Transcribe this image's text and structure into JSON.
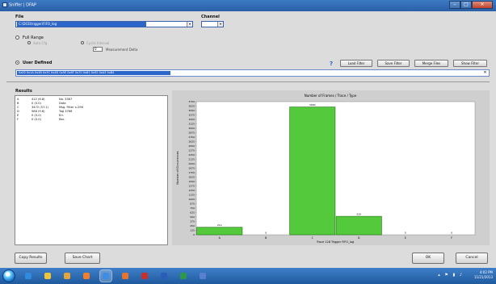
{
  "window": {
    "title": "Sniffer | DFAP",
    "controls": [
      "–",
      "□",
      "✕"
    ]
  },
  "file": {
    "label": "File",
    "value": "C:\\DCE\\trigger\\FIFO_log"
  },
  "channel": {
    "label": "Channel",
    "value": "1"
  },
  "options": {
    "full_range_label": "Full Range",
    "auto_label": "Auto Cfg",
    "opt2_label": "Cyclic Interval",
    "tiny_value": "0",
    "measurement_label": "Measurement Delta",
    "user_defined_label": "User Defined"
  },
  "toolbar": {
    "help_label": "?",
    "buttons": [
      "Load Filter",
      "Save Filter",
      "Merge Files",
      "Show Filter"
    ]
  },
  "user_input": {
    "value": "0x00 0x1A 0x2B 0x3C 0x4D 0x5E 0x6F 0x70 0x81 0x92 0xA3 0xB4"
  },
  "results": {
    "label": "Results",
    "rows": [
      {
        "key": "A",
        "col2": "412 (6.8)",
        "col3": "No. 3387"
      },
      {
        "key": "B",
        "col2": "0 (0.0)",
        "col3": "Data"
      },
      {
        "key": "C",
        "col2": "3472 (57.1)",
        "col3": "Msg. Filter x-296"
      },
      {
        "key": "D",
        "col2": "586 (9.6)",
        "col3": "Tag 3766"
      },
      {
        "key": "E",
        "col2": "0 (0.0)",
        "col3": "Err."
      },
      {
        "key": "F",
        "col2": "0 (0.0)",
        "col3": "Rec."
      }
    ]
  },
  "chart_data": {
    "type": "bar",
    "title": "Number of Frames / Trace / Type",
    "xlabel": "Trace 128 Trigger FIFO_log",
    "ylabel": "Number of Occurrences",
    "categories": [
      "A",
      "B",
      "C",
      "D",
      "E",
      "F"
    ],
    "values": [
      212,
      0,
      3600,
      520,
      0,
      0
    ],
    "data_labels": [
      "212",
      "0",
      "3600",
      "520",
      "0",
      "0"
    ],
    "ylim": [
      0,
      3750
    ],
    "ytick_labels": [
      "0",
      "125",
      "250",
      "375",
      "500",
      "625",
      "750",
      "875",
      "1000",
      "1125",
      "1250",
      "1375",
      "1500",
      "1625",
      "1750",
      "1875",
      "2000",
      "2125",
      "2250",
      "2375",
      "2500",
      "2625",
      "2750",
      "2875",
      "3000",
      "3125",
      "3250",
      "3375",
      "3500",
      "3625",
      "3750"
    ],
    "bar_color": "#55c93c",
    "bar_edge": "#1f6e12",
    "background": "#ffffff",
    "grid": false
  },
  "bottom": {
    "btn1": "Copy Results",
    "btn2": "Save Chart",
    "btn_ok": "OK",
    "btn_cancel": "Cancel"
  },
  "taskbar": {
    "time": "4:02 PM",
    "date": "11/21/2013",
    "apps": [
      "ie-icon",
      "chrome-icon",
      "folder-icon",
      "media-icon",
      "network-icon",
      "firefox-icon",
      "adobe-icon",
      "word-icon",
      "excel-icon",
      "app-icon"
    ],
    "active_index": 4,
    "tray_icons": "▴ ⚑ ▮ ♪"
  }
}
